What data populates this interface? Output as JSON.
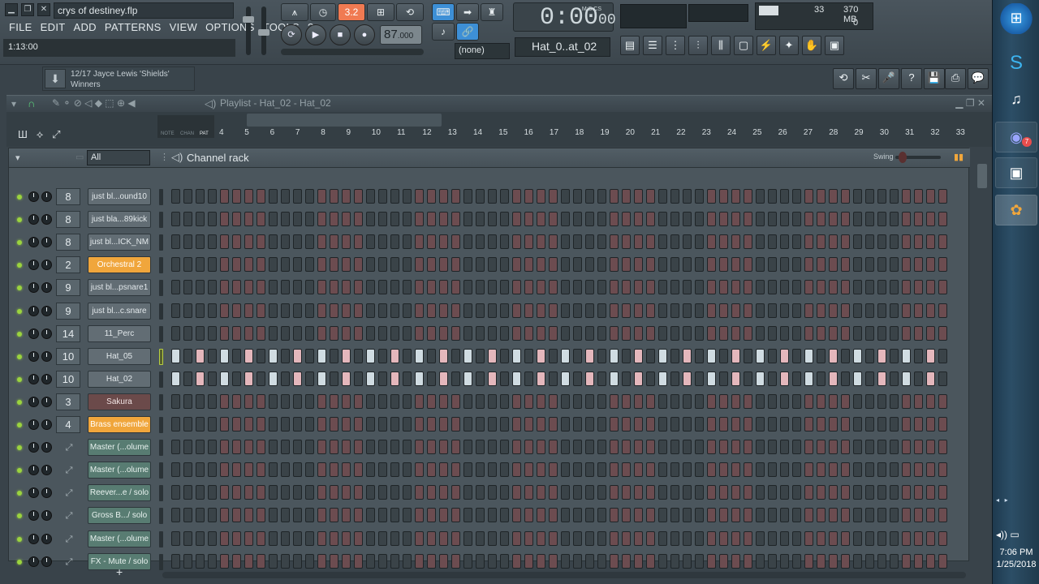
{
  "window": {
    "title": "crys of destiney.flp",
    "minimize_icon": "minimize-icon",
    "restore_icon": "restore-icon",
    "close_icon": "close-icon"
  },
  "menu": [
    "FILE",
    "EDIT",
    "ADD",
    "PATTERNS",
    "VIEW",
    "OPTIONS",
    "TOOLS",
    "?"
  ],
  "hint": {
    "text": "1:13:00"
  },
  "transport": {
    "pattern_song": "3.2",
    "tempo": "87",
    "tempo_fraction": ".000",
    "time": "0:00",
    "time_ms": "00",
    "time_label": "M:S:CS"
  },
  "system": {
    "cpu": "33",
    "memory": "370 MB",
    "polyphony": "0"
  },
  "snap": {
    "value": "(none)"
  },
  "pattern": {
    "name": "Hat_0..at_02"
  },
  "song_info": {
    "counter": "12/17",
    "artist_title": "Jayce Lewis 'Shields'",
    "line2": "Winners"
  },
  "playlist": {
    "title": "Playlist - Hat_02 - Hat_02",
    "tabs": [
      "NOTE",
      "CHAN",
      "PAT"
    ],
    "ruler": [
      "4",
      "5",
      "6",
      "7",
      "8",
      "9",
      "10",
      "11",
      "12",
      "13",
      "14",
      "15",
      "16",
      "17",
      "18",
      "19",
      "20",
      "21",
      "22",
      "23",
      "24",
      "25",
      "26",
      "27",
      "28",
      "29",
      "30",
      "31",
      "32",
      "33"
    ]
  },
  "rack": {
    "title": "Channel rack",
    "filter": "All",
    "swing_label": "Swing",
    "add_label": "+",
    "channels": [
      {
        "mixer": "8",
        "name": "just bl...ound10",
        "style": "gray",
        "hat": false
      },
      {
        "mixer": "8",
        "name": "just bla...89kick",
        "style": "gray",
        "hat": false
      },
      {
        "mixer": "8",
        "name": "just bl...ICK_NM",
        "style": "gray",
        "hat": false
      },
      {
        "mixer": "2",
        "name": "Orchestral 2",
        "style": "orange",
        "hat": false
      },
      {
        "mixer": "9",
        "name": "just bl...psnare1",
        "style": "gray",
        "hat": false
      },
      {
        "mixer": "9",
        "name": "just bl...c.snare",
        "style": "gray",
        "hat": false
      },
      {
        "mixer": "14",
        "name": "11_Perc",
        "style": "gray",
        "hat": false
      },
      {
        "mixer": "10",
        "name": "Hat_05",
        "style": "gray",
        "hat": true,
        "selected": true
      },
      {
        "mixer": "10",
        "name": "Hat_02",
        "style": "gray",
        "hat": true
      },
      {
        "mixer": "3",
        "name": "Sakura",
        "style": "maroon",
        "hat": false
      },
      {
        "mixer": "4",
        "name": "Brass ensemble",
        "style": "orange",
        "hat": false
      },
      {
        "mixer": "",
        "name": "Master (...olume",
        "style": "teal",
        "hat": false,
        "auto": true
      },
      {
        "mixer": "",
        "name": "Master (...olume",
        "style": "teal",
        "hat": false,
        "auto": true
      },
      {
        "mixer": "",
        "name": "Reever...e / solo",
        "style": "teal",
        "hat": false,
        "auto": true
      },
      {
        "mixer": "",
        "name": "Gross B.../ solo",
        "style": "teal",
        "hat": false,
        "auto": true
      },
      {
        "mixer": "",
        "name": "Master (...olume",
        "style": "teal",
        "hat": false,
        "auto": true
      },
      {
        "mixer": "",
        "name": "FX - Mute / solo",
        "style": "teal",
        "hat": false,
        "auto": true
      }
    ]
  },
  "taskbar": {
    "time": "7:06 PM",
    "date": "1/25/2018",
    "apps": [
      "start-orb-icon",
      "skype-icon",
      "music-icon",
      "discord-icon",
      "monitor-icon",
      "fl-studio-icon"
    ],
    "discord_badge": "7"
  },
  "colors": {
    "accent_orange": "#f0a63c",
    "led_green": "#9bd43e",
    "step_red": "#6c4c50",
    "step_white": "#d0dce2",
    "step_pink": "#e4b7bc"
  }
}
